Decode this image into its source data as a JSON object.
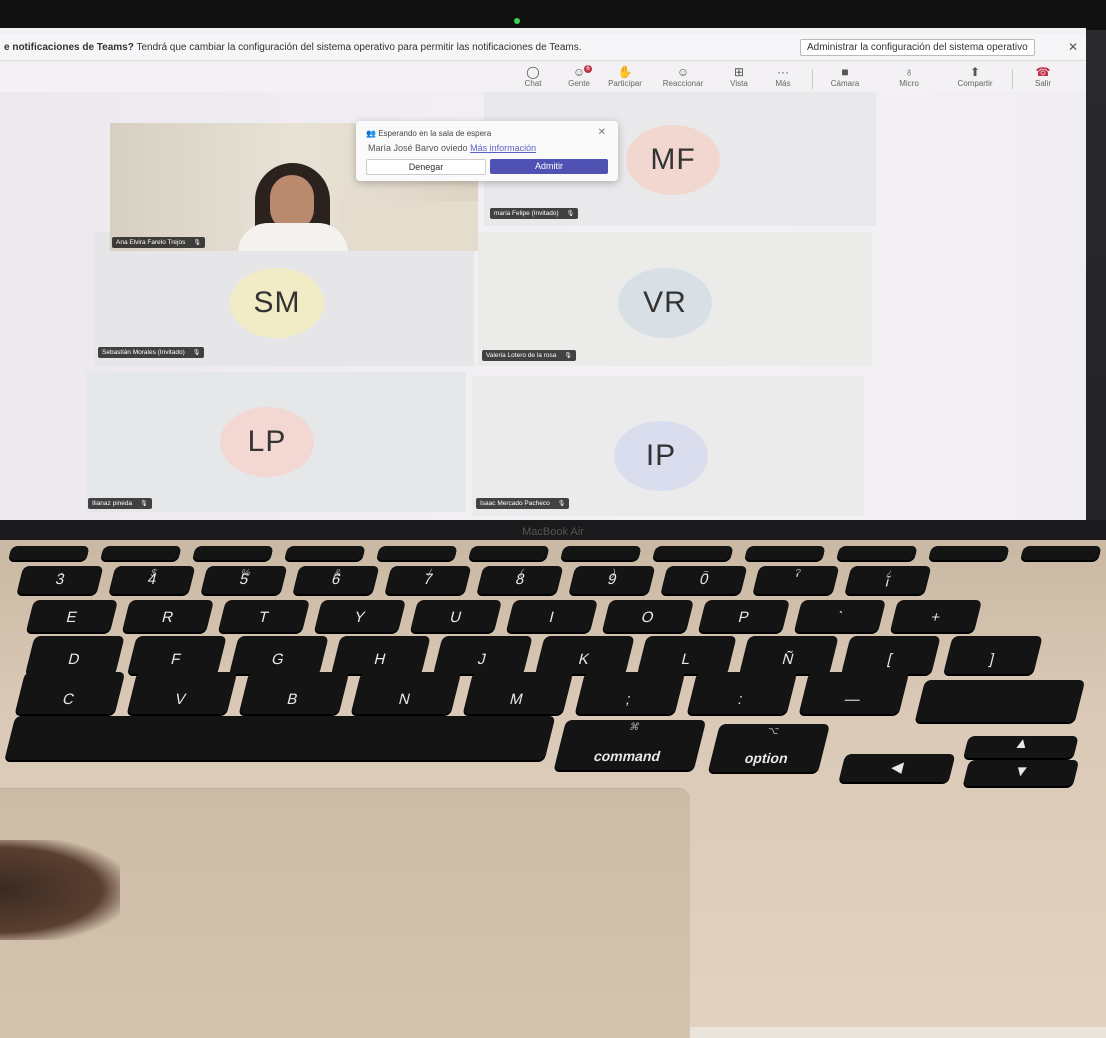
{
  "notification": {
    "text_bold": "e notificaciones de Teams?",
    "text_rest": " Tendrá que cambiar la configuración del sistema operativo para permitir las notificaciones de Teams.",
    "button_label": "Administrar la configuración del sistema operativo",
    "close_icon": "✕"
  },
  "toolbar": {
    "chat": "Chat",
    "people": "Gente",
    "people_badge": "6",
    "raise": "Participar",
    "react": "Reaccionar",
    "view": "Vista",
    "more": "Más",
    "camera": "Cámara",
    "mic": "Micro",
    "share": "Compartir",
    "leave": "Salir"
  },
  "lobby_popup": {
    "title": "Esperando en la sala de espera",
    "person": "María José Barvo oviedo",
    "link": "Más información",
    "deny": "Denegar",
    "admit": "Admitir"
  },
  "participants": [
    {
      "name": "Ana Elvira Farelo Trejos",
      "initials": "",
      "color": "#d6cbbd"
    },
    {
      "name": "maria Felipe (Invitado)",
      "initials": "MF",
      "color": "#f1d7d0"
    },
    {
      "name": "Sebastián Morales (Invitado)",
      "initials": "SM",
      "color": "#f1ebc6"
    },
    {
      "name": "Valeria Lotero de la rosa",
      "initials": "VR",
      "color": "#d8e0e6"
    },
    {
      "name": "Ilianaz pineda",
      "initials": "LP",
      "color": "#f2d7d3"
    },
    {
      "name": "Isaac Mercado Pacheco",
      "initials": "IP",
      "color": "#d9ddee"
    }
  ],
  "brand": "MacBook Air",
  "keyboard": {
    "row_num": [
      [
        "·",
        "3"
      ],
      [
        "$",
        "4"
      ],
      [
        "%",
        "5"
      ],
      [
        "&",
        "6"
      ],
      [
        "/",
        "7"
      ],
      [
        "(",
        "8"
      ],
      [
        ")",
        "9"
      ],
      [
        "=",
        "0"
      ],
      [
        "?",
        "'"
      ],
      [
        "¿",
        "¡"
      ]
    ],
    "row_q": [
      "E",
      "R",
      "T",
      "Y",
      "U",
      "I",
      "O",
      "P",
      "`",
      "+"
    ],
    "row_a": [
      "D",
      "F",
      "G",
      "H",
      "J",
      "K",
      "L",
      "Ñ",
      "[",
      "]"
    ],
    "row_z": [
      "C",
      "V",
      "B",
      "N",
      "M",
      ";",
      ":",
      "—"
    ],
    "cmd_symbol": "⌘",
    "cmd_label": "command",
    "opt_symbol": "⌥",
    "opt_label": "option",
    "arrow_left": "◀",
    "arrow_up": "▲",
    "arrow_down": "▼"
  }
}
